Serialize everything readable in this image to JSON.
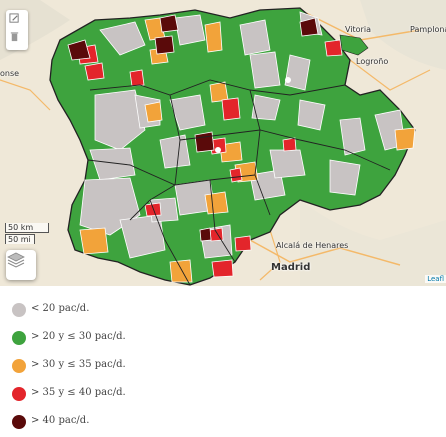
{
  "map": {
    "cities": {
      "vitoria": "Vitoria",
      "pamplona": "Pamplona",
      "logrono": "Logroño",
      "alcala": "Alcalá de Henares",
      "madrid": "Madrid",
      "partial_left": "onse"
    },
    "scale": {
      "km": "50 km",
      "mi": "50 mi"
    },
    "attribution": "Leafl",
    "icons": {
      "draw": "pencil-edit-icon",
      "delete": "trash-icon",
      "layers": "layers-icon"
    }
  },
  "legend": {
    "items": [
      {
        "label": "< 20 pac/d.",
        "color": "#c8c3c3"
      },
      {
        "label": "> 20 y ≤ 30 pac/d.",
        "color": "#3ea33e"
      },
      {
        "label": "> 30 y ≤ 35 pac/d.",
        "color": "#f2a33a"
      },
      {
        "label": "> 35 y ≤ 40 pac/d.",
        "color": "#e3252b"
      },
      {
        "label": "> 40 pac/d.",
        "color": "#5a0a0a"
      }
    ]
  },
  "colors": {
    "background_map": "#efe8d8",
    "region_outline": "#222222",
    "cell_border": "#ffffff"
  }
}
